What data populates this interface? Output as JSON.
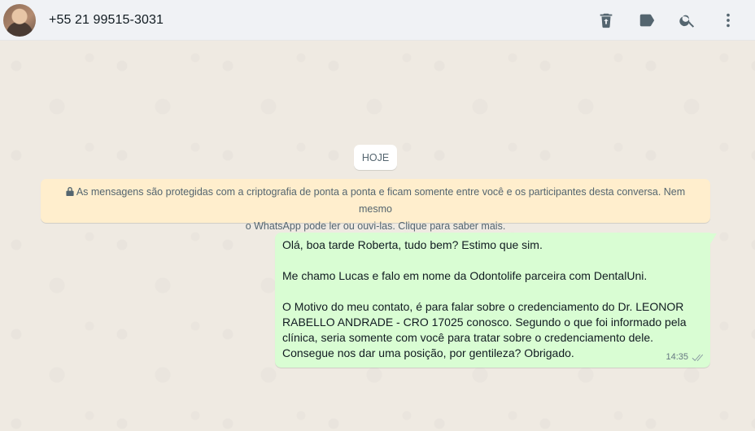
{
  "header": {
    "contact": "+55 21 99515-3031",
    "icons": [
      "delete-icon",
      "label-icon",
      "search-icon",
      "menu-icon"
    ]
  },
  "chat": {
    "date_chip": "HOJE",
    "encryption_notice": {
      "line1": "As mensagens são protegidas com a criptografia de ponta a ponta e ficam somente entre você e os participantes desta conversa. Nem mesmo",
      "line2": "o WhatsApp pode ler ou ouvi-las. Clique para saber mais."
    },
    "message": {
      "lines": [
        "Olá, boa tarde Roberta, tudo bem? Estimo que sim.",
        "",
        "Me chamo Lucas e falo em nome da Odontolife parceira com DentalUni.",
        "",
        "O Motivo do meu contato, é para falar sobre o credenciamento do Dr. LEONOR",
        "RABELLO ANDRADE - CRO 17025 conosco. Segundo o que foi informado pela",
        "clínica, seria somente com você para tratar sobre o credenciamento dele.",
        "Consegue nos dar uma posição, por gentileza? Obrigado."
      ],
      "time": "14:35",
      "status": "read"
    }
  },
  "colors": {
    "header_bg": "#f0f2f5",
    "chat_bg": "#efeae2",
    "outgoing_bubble": "#d9fdd3",
    "notice_bg": "#ffeecd",
    "icon": "#54656f"
  }
}
